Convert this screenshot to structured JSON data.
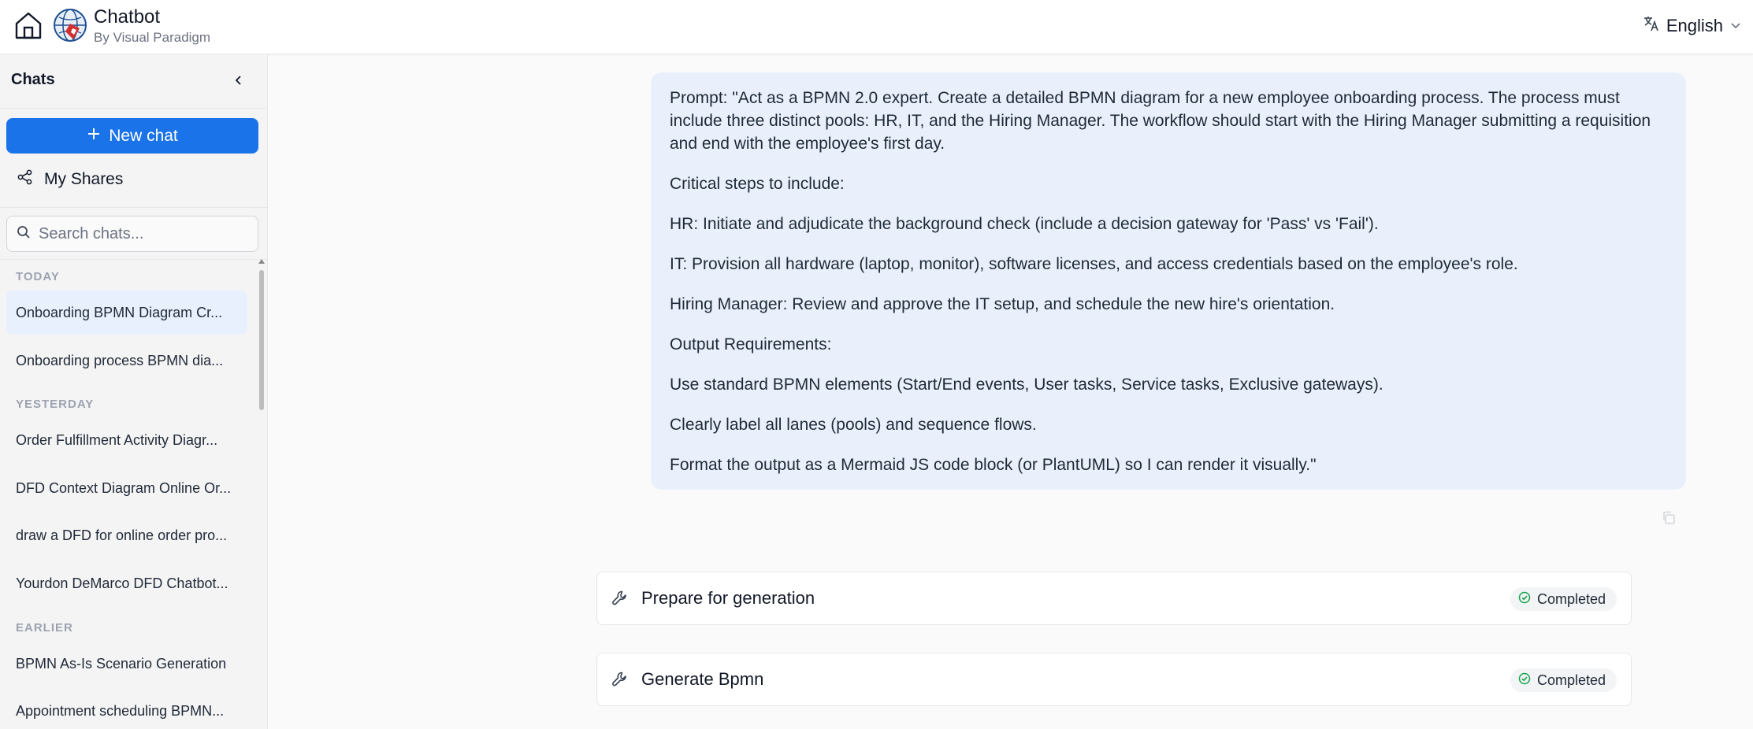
{
  "header": {
    "title": "Chatbot",
    "subtitle": "By Visual Paradigm",
    "language": "English",
    "home_icon": "home-icon",
    "logo_icon": "visual-paradigm-logo"
  },
  "sidebar": {
    "title": "Chats",
    "new_chat_label": "New chat",
    "my_shares_label": "My Shares",
    "search_placeholder": "Search chats...",
    "sections": [
      {
        "label": "TODAY",
        "items": [
          "Onboarding BPMN Diagram Cr...",
          "Onboarding process BPMN dia..."
        ]
      },
      {
        "label": "YESTERDAY",
        "items": [
          "Order Fulfillment Activity Diagr...",
          "DFD Context Diagram Online Or...",
          "draw a DFD for online order pro...",
          "Yourdon DeMarco DFD Chatbot..."
        ]
      },
      {
        "label": "EARLIER",
        "items": [
          "BPMN As-Is Scenario Generation",
          "Appointment scheduling BPMN..."
        ]
      }
    ],
    "active_item": "Onboarding BPMN Diagram Cr..."
  },
  "message": {
    "paragraphs": [
      "Prompt: \"Act as a BPMN 2.0 expert. Create a detailed BPMN diagram for a new employee onboarding process. The process must include three distinct pools: HR, IT, and the Hiring Manager. The workflow should start with the Hiring Manager submitting a requisition and end with the employee's first day.",
      "Critical steps to include:",
      "HR: Initiate and adjudicate the background check (include a decision gateway for 'Pass' vs 'Fail').",
      "IT: Provision all hardware (laptop, monitor), software licenses, and access credentials based on the employee's role.",
      "Hiring Manager: Review and approve the IT setup, and schedule the new hire's orientation.",
      "Output Requirements:",
      "Use standard BPMN elements (Start/End events, User tasks, Service tasks, Exclusive gateways).",
      "Clearly label all lanes (pools) and sequence flows.",
      "Format the output as a Mermaid JS code block (or PlantUML) so I can render it visually.\""
    ]
  },
  "steps": [
    {
      "label": "Prepare for generation",
      "status": "Completed"
    },
    {
      "label": "Generate Bpmn",
      "status": "Completed"
    }
  ],
  "colors": {
    "accent": "#1a73e8",
    "bubble": "#e9f0fc",
    "success": "#16a34a"
  }
}
